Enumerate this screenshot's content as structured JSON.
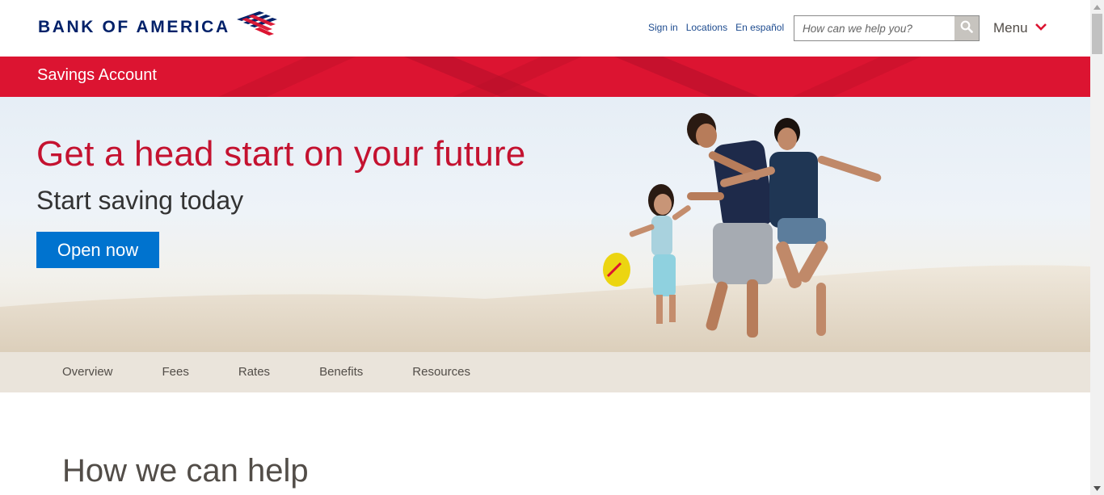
{
  "header": {
    "logo_text": "BANK OF AMERICA",
    "links": [
      "Sign in",
      "Locations",
      "En español"
    ],
    "search_placeholder": "How can we help you?",
    "menu_label": "Menu"
  },
  "banner": {
    "title": "Savings Account"
  },
  "hero": {
    "headline": "Get a head start on your future",
    "subheadline": "Start saving today",
    "cta_label": "Open now"
  },
  "subnav": {
    "items": [
      "Overview",
      "Fees",
      "Rates",
      "Benefits",
      "Resources"
    ]
  },
  "main": {
    "section_title": "How we can help"
  },
  "colors": {
    "brand_red": "#dc1431",
    "brand_navy": "#012169",
    "cta_blue": "#0073cf",
    "headline_red": "#c41230"
  },
  "icons": {
    "search": "search-icon",
    "menu": "chevron-down-icon",
    "logo": "flag-logo-icon"
  }
}
